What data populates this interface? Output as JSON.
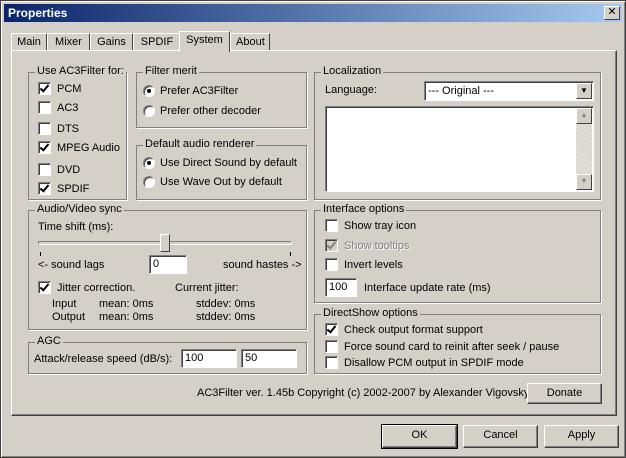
{
  "window": {
    "title": "Properties",
    "close_glyph": "✕"
  },
  "tabs": [
    {
      "label": "Main"
    },
    {
      "label": "Mixer"
    },
    {
      "label": "Gains"
    },
    {
      "label": "SPDIF"
    },
    {
      "label": "System"
    },
    {
      "label": "About"
    }
  ],
  "active_tab": "System",
  "use_ac3filter": {
    "title": "Use AC3Filter for:",
    "items": [
      {
        "label": "PCM",
        "checked": true
      },
      {
        "label": "AC3",
        "checked": false
      },
      {
        "label": "DTS",
        "checked": false
      },
      {
        "label": "MPEG Audio",
        "checked": true
      },
      {
        "label": "DVD",
        "checked": false
      },
      {
        "label": "SPDIF",
        "checked": true
      }
    ]
  },
  "filter_merit": {
    "title": "Filter merit",
    "options": [
      {
        "label": "Prefer AC3Filter",
        "selected": true
      },
      {
        "label": "Prefer other decoder",
        "selected": false
      }
    ]
  },
  "default_renderer": {
    "title": "Default audio renderer",
    "options": [
      {
        "label": "Use Direct Sound by default",
        "selected": true
      },
      {
        "label": "Use Wave Out by default",
        "selected": false
      }
    ]
  },
  "localization": {
    "title": "Localization",
    "language_label": "Language:",
    "language_value": "--- Original ---"
  },
  "av_sync": {
    "title": "Audio/Video sync",
    "time_shift_label": "Time shift (ms):",
    "left_label": "<- sound lags",
    "right_label": "sound hastes ->",
    "time_shift_value": "0",
    "slider_fraction": 0.5,
    "jitter_label": "Jitter correction.",
    "jitter_checked": true,
    "current_jitter_label": "Current jitter:",
    "input_label": "Input",
    "output_label": "Output",
    "input_mean": "mean: 0ms",
    "output_mean": "mean: 0ms",
    "input_stddev": "stddev: 0ms",
    "output_stddev": "stddev: 0ms"
  },
  "agc": {
    "title": "AGC",
    "label": "Attack/release speed (dB/s):",
    "attack": "100",
    "release": "50"
  },
  "interface_options": {
    "title": "Interface options",
    "show_tray": {
      "label": "Show tray icon",
      "checked": false
    },
    "show_tooltips": {
      "label": "Show tooltips",
      "checked": true,
      "disabled": true
    },
    "invert_levels": {
      "label": "Invert levels",
      "checked": false
    },
    "update_rate_value": "100",
    "update_rate_label": "Interface update rate (ms)"
  },
  "directshow_options": {
    "title": "DirectShow options",
    "items": [
      {
        "label": "Check output format support",
        "checked": true
      },
      {
        "label": "Force sound card to reinit after seek / pause",
        "checked": false
      },
      {
        "label": "Disallow PCM output in SPDIF mode",
        "checked": false
      }
    ]
  },
  "footer": {
    "copyright": "AC3Filter ver. 1.45b Copyright (c) 2002-2007 by Alexander Vigovsky",
    "donate": "Donate",
    "ok": "OK",
    "cancel": "Cancel",
    "apply": "Apply"
  }
}
